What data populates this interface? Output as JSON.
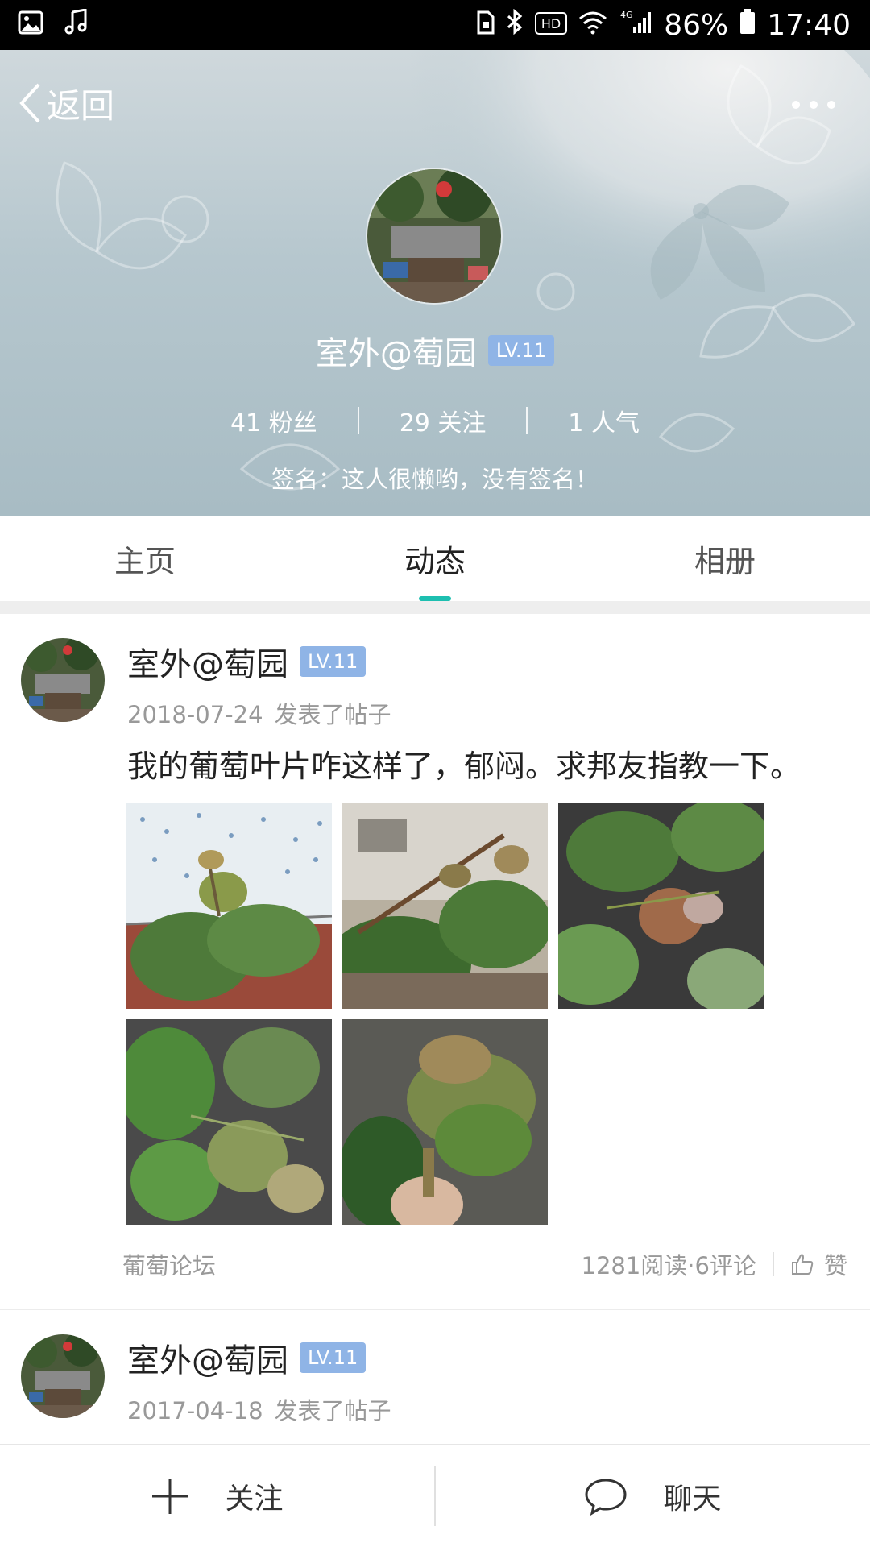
{
  "status_bar": {
    "battery": "86%",
    "time": "17:40",
    "hd_label": "HD",
    "network_label": "4G",
    "icons": [
      "image-icon",
      "music-icon",
      "sim-lock-icon",
      "bluetooth-icon",
      "hd-icon",
      "wifi-icon",
      "signal-icon",
      "battery-icon"
    ]
  },
  "header": {
    "back_label": "返回",
    "more_icon": "more-icon",
    "name": "室外@萄园",
    "level": "LV.11",
    "stats": {
      "fans": "41 粉丝",
      "following": "29 关注",
      "popularity": "1 人气"
    },
    "signature": "签名：这人很懒哟，没有签名！"
  },
  "tabs": [
    {
      "label": "主页",
      "active": false
    },
    {
      "label": "动态",
      "active": true
    },
    {
      "label": "相册",
      "active": false
    }
  ],
  "posts": [
    {
      "name": "室外@萄园",
      "level": "LV.11",
      "date": "2018-07-24",
      "action": "发表了帖子",
      "text": "我的葡萄叶片咋这样了，郁闷。求邦友指教一下。",
      "image_count": 5,
      "forum": "葡萄论坛",
      "reads_comments": "1281阅读·6评论",
      "like_label": "赞"
    },
    {
      "name": "室外@萄园",
      "level": "LV.11",
      "date": "2017-04-18",
      "action": "发表了帖子"
    }
  ],
  "bottom_bar": {
    "follow_label": "关注",
    "chat_label": "聊天"
  },
  "colors": {
    "accent": "#1dbfb0",
    "level_badge": "#8fb4e6",
    "header_bg": "#b6c7ce"
  }
}
